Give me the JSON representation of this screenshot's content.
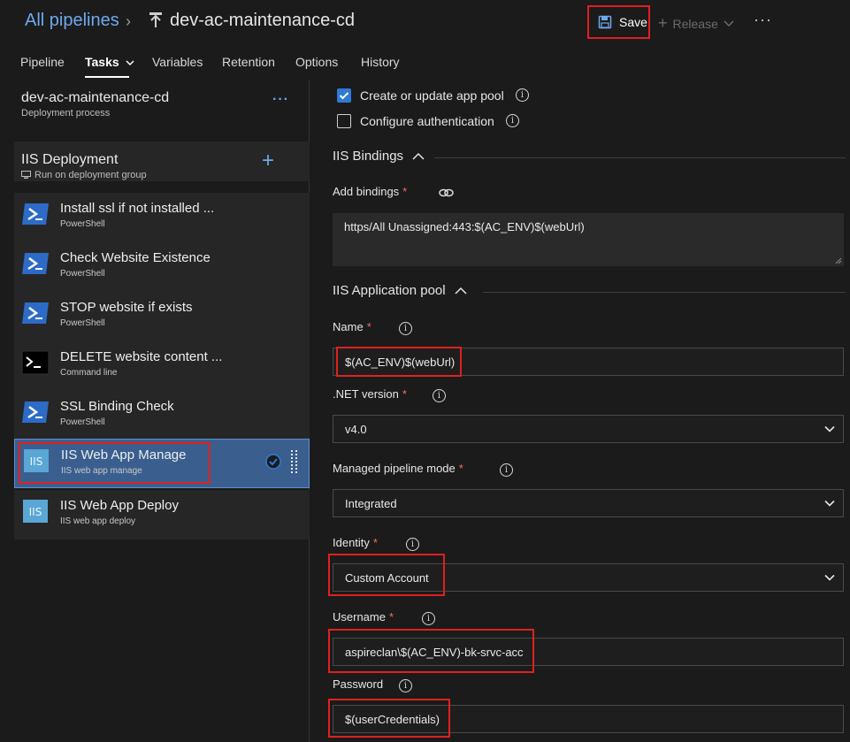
{
  "header": {
    "all_pipelines": "All pipelines",
    "pipeline_name": "dev-ac-maintenance-cd",
    "save_label": "Save",
    "release_label": "Release",
    "more": "···"
  },
  "tabs": [
    "Pipeline",
    "Tasks",
    "Variables",
    "Retention",
    "Options",
    "History"
  ],
  "process": {
    "title": "dev-ac-maintenance-cd",
    "subtitle": "Deployment process",
    "more": "···"
  },
  "job": {
    "title": "IIS Deployment",
    "subtitle": "Run on deployment group",
    "add": "+"
  },
  "tasks": [
    {
      "title": "Install ssl if not installed ...",
      "subtitle": "PowerShell",
      "icon": "powershell-icon"
    },
    {
      "title": "Check Website Existence",
      "subtitle": "PowerShell",
      "icon": "powershell-icon"
    },
    {
      "title": "STOP website if exists",
      "subtitle": "PowerShell",
      "icon": "powershell-icon"
    },
    {
      "title": "DELETE website content ...",
      "subtitle": "Command line",
      "icon": "command-line-icon"
    },
    {
      "title": "SSL Binding Check",
      "subtitle": "PowerShell",
      "icon": "powershell-icon"
    },
    {
      "title": "IIS Web App Manage",
      "subtitle": "IIS web app manage",
      "icon": "iis-icon"
    },
    {
      "title": "IIS Web App Deploy",
      "subtitle": "IIS web app deploy",
      "icon": "iis-icon"
    }
  ],
  "iis_icon_text": "IIS",
  "form": {
    "create_app_pool": {
      "label": "Create or update app pool",
      "checked": true
    },
    "configure_auth": {
      "label": "Configure authentication",
      "checked": false
    },
    "bindings_section": "IIS Bindings",
    "add_bindings_label": "Add bindings",
    "bindings_value": "https/All Unassigned:443:$(AC_ENV)$(webUrl)",
    "app_pool_section": "IIS Application pool",
    "name_label": "Name",
    "name_value": "$(AC_ENV)$(webUrl)",
    "net_version_label": ".NET version",
    "net_version_value": "v4.0",
    "pipeline_mode_label": "Managed pipeline mode",
    "pipeline_mode_value": "Integrated",
    "identity_label": "Identity",
    "identity_value": "Custom Account",
    "username_label": "Username",
    "username_value": "aspireclan\\$(AC_ENV)-bk-srvc-acc",
    "password_label": "Password",
    "password_value": "$(userCredentials)",
    "required_mark": "*",
    "info_glyph": "i"
  },
  "colors": {
    "accent": "#6ea9ee",
    "highlight_box": "#e02020",
    "selected_task": "#3a5f8f",
    "checkbox_on": "#2f7ad6",
    "powershell": "#2d6bc7",
    "iis": "#5aa7d6"
  }
}
